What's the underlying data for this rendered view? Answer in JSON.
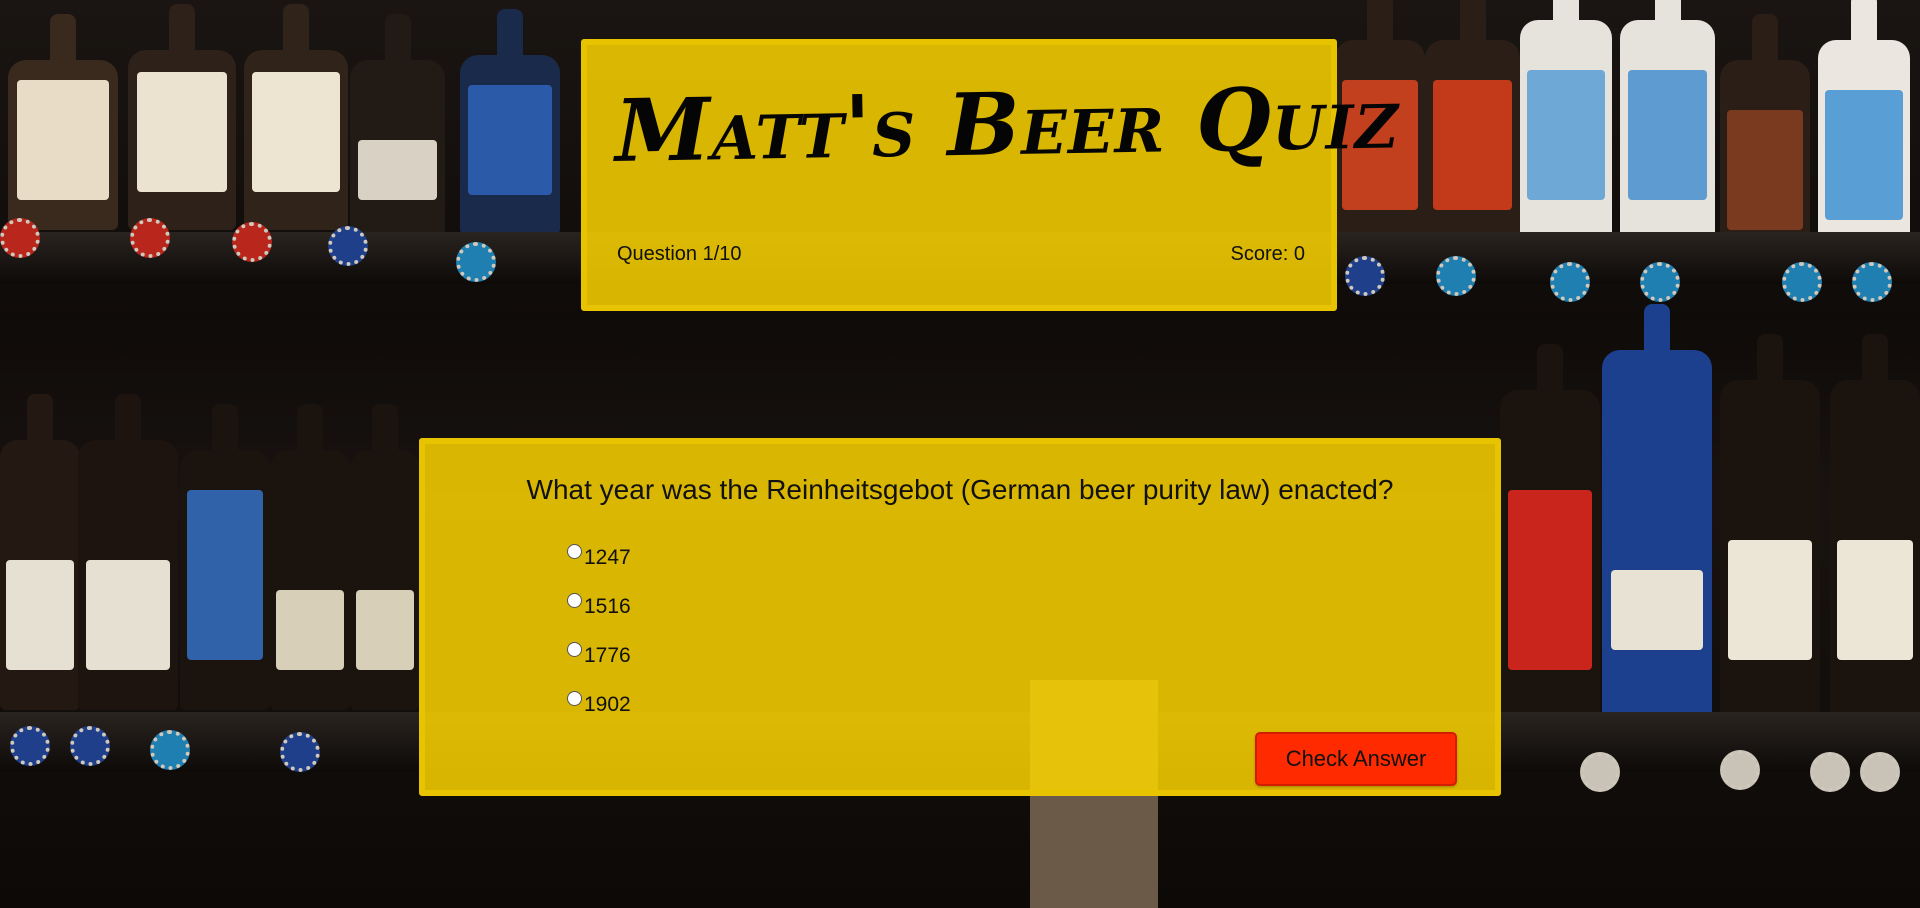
{
  "header": {
    "title": "Matt's Beer Quiz",
    "question_counter": "Question 1/10",
    "score": "Score: 0"
  },
  "question": {
    "text": "What year was the Reinheitsgebot (German beer purity law) enacted?",
    "options": [
      "1247",
      "1516",
      "1776",
      "1902"
    ],
    "check_button_label": "Check Answer"
  },
  "colors": {
    "card_background": "#ffd600",
    "card_border": "#e8c300",
    "button_background": "#ff2a00"
  }
}
